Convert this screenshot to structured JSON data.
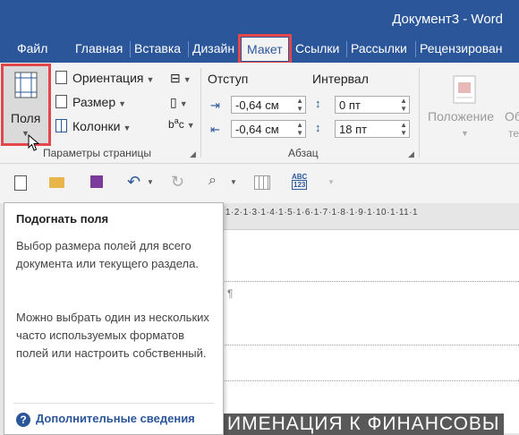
{
  "window": {
    "title": "Документ3 - Word"
  },
  "tabs": [
    {
      "label": "Файл"
    },
    {
      "label": "Главная"
    },
    {
      "label": "Вставка"
    },
    {
      "label": "Дизайн"
    },
    {
      "label": "Макет"
    },
    {
      "label": "Ссылки"
    },
    {
      "label": "Рассылки"
    },
    {
      "label": "Рецензирован"
    }
  ],
  "active_tab": "Макет",
  "ribbon": {
    "margins_button": "Поля",
    "orientation": "Ориентация",
    "size": "Размер",
    "columns": "Колонки",
    "page_setup_label": "Параметры страницы",
    "indent_label": "Отступ",
    "spacing_label": "Интервал",
    "indent_left_value": "-0,64 см",
    "indent_right_value": "-0,64 см",
    "spacing_before_value": "0 пт",
    "spacing_after_value": "18 пт",
    "paragraph_label": "Абзац",
    "position_label": "Положение",
    "wrap_text_partial": "Об",
    "wrap_text_partial_2": "те"
  },
  "ruler": {
    "text": "·1·2·1·3·1·4·1·5·1·6·1·7·1·8·1·9·1·10·1·11·1"
  },
  "document": {
    "paragraph_mark": "¶",
    "heading_partial": "ИМЕНАЦИЯ К ФИНАНСОВЫ"
  },
  "tooltip": {
    "title": "Подогнать поля",
    "paragraph1": "Выбор размера полей для всего документа или текущего раздела.",
    "paragraph2": "Можно выбрать один из нескольких часто используемых форматов полей или настроить собственный.",
    "more_info": "Дополнительные сведения"
  },
  "colors": {
    "titlebar": "#2b579a",
    "highlight": "#e4474b",
    "ribbon_bg": "#f3f3f3"
  }
}
